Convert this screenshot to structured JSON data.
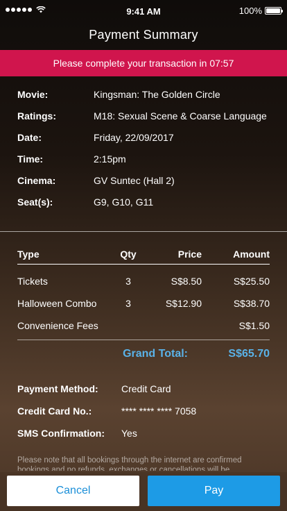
{
  "status_bar": {
    "time": "9:41 AM",
    "battery": "100%"
  },
  "header": {
    "title": "Payment Summary"
  },
  "timer_banner": {
    "text": "Please complete your transaction in 07:57"
  },
  "booking": {
    "rows": [
      {
        "label": "Movie:",
        "value": "Kingsman: The Golden Circle"
      },
      {
        "label": "Ratings:",
        "value": "M18: Sexual Scene & Coarse Language"
      },
      {
        "label": "Date:",
        "value": "Friday, 22/09/2017"
      },
      {
        "label": "Time:",
        "value": "2:15pm"
      },
      {
        "label": "Cinema:",
        "value": "GV Suntec (Hall 2)"
      },
      {
        "label": "Seat(s):",
        "value": "G9, G10, G11"
      }
    ]
  },
  "table": {
    "headers": {
      "type": "Type",
      "qty": "Qty",
      "price": "Price",
      "amount": "Amount"
    },
    "rows": [
      {
        "type": "Tickets",
        "qty": "3",
        "price": "S$8.50",
        "amount": "S$25.50"
      },
      {
        "type": "Halloween Combo",
        "qty": "3",
        "price": "S$12.90",
        "amount": "S$38.70"
      },
      {
        "type": "Convenience Fees",
        "qty": "",
        "price": "",
        "amount": "S$1.50"
      }
    ],
    "grand_total_label": "Grand Total:",
    "grand_total_value": "S$65.70"
  },
  "payment": {
    "rows": [
      {
        "label": "Payment Method:",
        "value": "Credit Card"
      },
      {
        "label": "Credit Card No.:",
        "value": "**** **** **** 7058"
      },
      {
        "label": "SMS Confirmation:",
        "value": "Yes"
      }
    ],
    "note": "Please note that all bookings through the internet are confirmed bookings and no refunds, exchanges or cancellations will be"
  },
  "actions": {
    "cancel_label": "Cancel",
    "pay_label": "Pay"
  },
  "colors": {
    "banner": "#d0154d",
    "accent": "#5ab2e8",
    "pay_button": "#1d9be6"
  }
}
